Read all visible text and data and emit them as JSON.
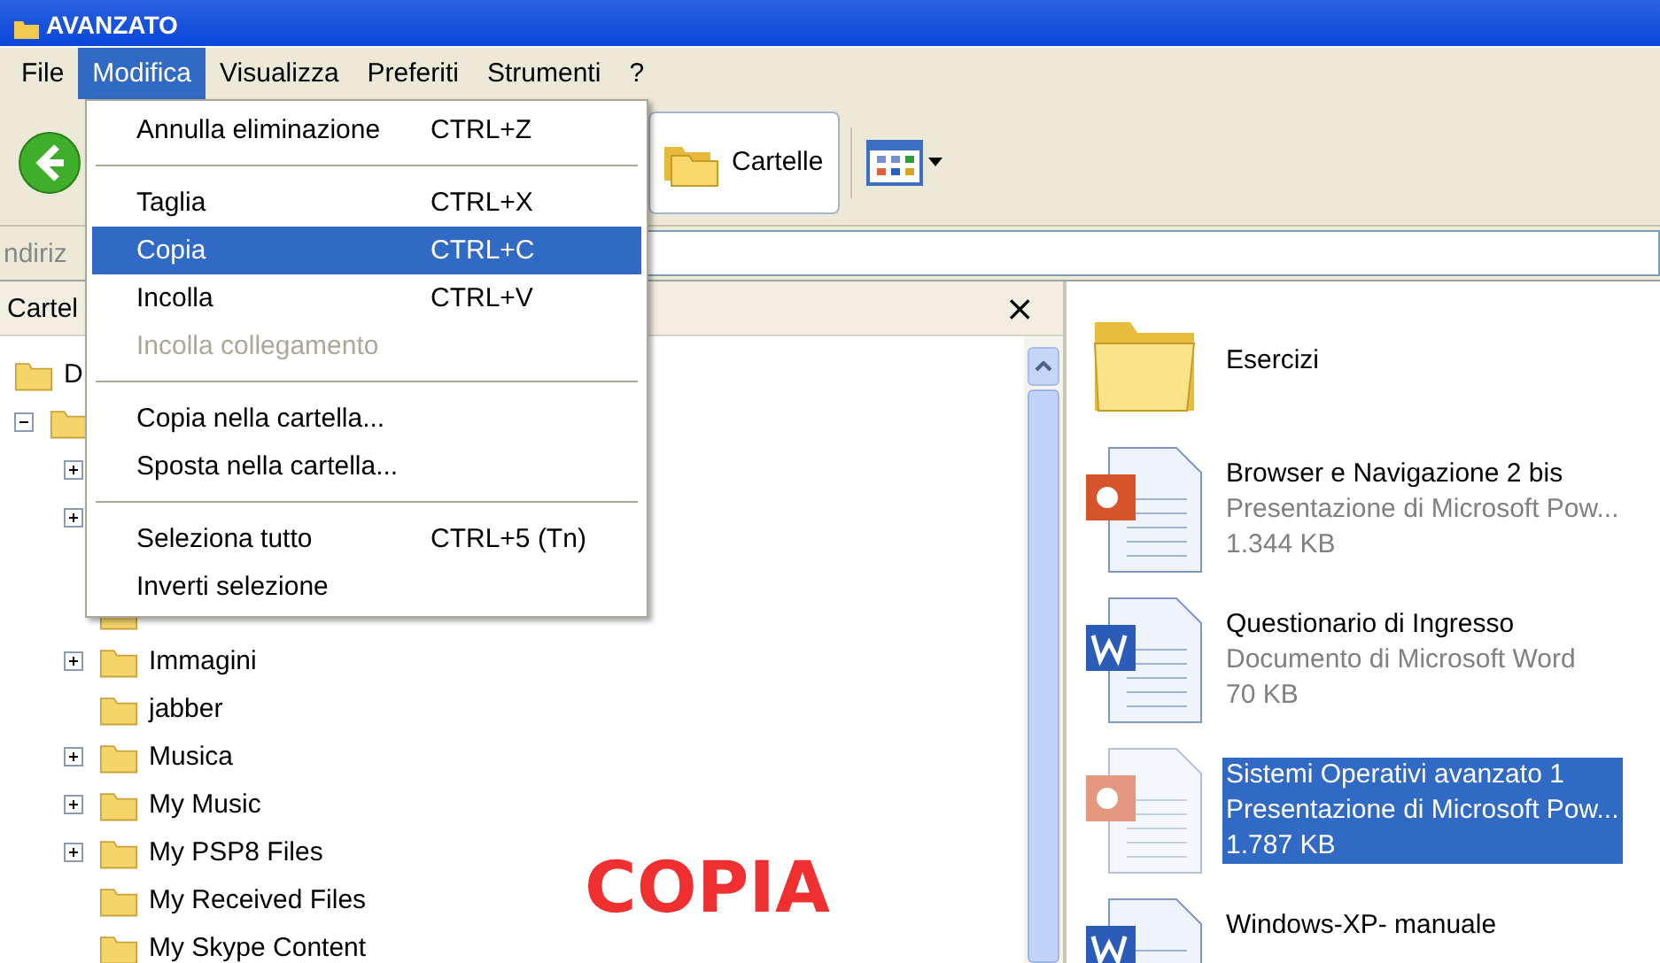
{
  "window": {
    "title": "AVANZATO"
  },
  "menu_bar": [
    {
      "label": "File",
      "selected": false
    },
    {
      "label": "Modifica",
      "selected": true
    },
    {
      "label": "Visualizza",
      "selected": false
    },
    {
      "label": "Preferiti",
      "selected": false
    },
    {
      "label": "Strumenti",
      "selected": false
    },
    {
      "label": "?",
      "selected": false
    }
  ],
  "toolbar": {
    "folders_button": "Cartelle"
  },
  "address_bar": {
    "label": "ndiriz"
  },
  "folders_pane": {
    "title": "Cartel",
    "close": "×",
    "tree": [
      {
        "label": "D",
        "kind": "leaf"
      },
      {
        "kind": "node",
        "expanded": true,
        "children": [
          {
            "kind": "node",
            "expanded": false
          },
          {
            "kind": "node",
            "expanded": false
          },
          {
            "kind": "leaf"
          },
          {
            "kind": "leaf"
          },
          {
            "label": "Immagini",
            "kind": "node",
            "expanded": false
          },
          {
            "label": "jabber",
            "kind": "leaf"
          },
          {
            "label": "Musica",
            "kind": "node",
            "expanded": false
          },
          {
            "label": "My Music",
            "kind": "node",
            "expanded": false
          },
          {
            "label": "My PSP8 Files",
            "kind": "node",
            "expanded": false
          },
          {
            "label": "My Received Files",
            "kind": "leaf"
          },
          {
            "label": "My Skype Content",
            "kind": "leaf"
          }
        ]
      }
    ]
  },
  "edit_menu": [
    {
      "kind": "item",
      "label": "Annulla eliminazione",
      "shortcut": "CTRL+Z",
      "selected": false,
      "disabled": false
    },
    {
      "kind": "separator"
    },
    {
      "kind": "item",
      "label": "Taglia",
      "shortcut": "CTRL+X",
      "selected": false,
      "disabled": false
    },
    {
      "kind": "item",
      "label": "Copia",
      "shortcut": "CTRL+C",
      "selected": true,
      "disabled": false
    },
    {
      "kind": "item",
      "label": "Incolla",
      "shortcut": "CTRL+V",
      "selected": false,
      "disabled": false
    },
    {
      "kind": "item",
      "label": "Incolla collegamento",
      "selected": false,
      "disabled": true
    },
    {
      "kind": "separator"
    },
    {
      "kind": "item",
      "label": "Copia nella cartella...",
      "selected": false,
      "disabled": false
    },
    {
      "kind": "item",
      "label": "Sposta nella cartella...",
      "selected": false,
      "disabled": false
    },
    {
      "kind": "separator"
    },
    {
      "kind": "item",
      "label": "Seleziona tutto",
      "shortcut": "CTRL+5 (Tn)",
      "selected": false,
      "disabled": false
    },
    {
      "kind": "item",
      "label": "Inverti selezione",
      "selected": false,
      "disabled": false
    }
  ],
  "files": [
    {
      "kind": "folder",
      "name": "Esercizi",
      "selected": false
    },
    {
      "kind": "presentation",
      "name": "Browser e Navigazione 2 bis",
      "type": "Presentazione di Microsoft Pow...",
      "size": "1.344 KB",
      "selected": false
    },
    {
      "kind": "document",
      "name": "Questionario di Ingresso",
      "type": "Documento di Microsoft Word",
      "size": "70 KB",
      "selected": false
    },
    {
      "kind": "presentation",
      "name": "Sistemi Operativi avanzato 1",
      "type": "Presentazione di Microsoft Pow...",
      "size": "1.787 KB",
      "selected": true
    },
    {
      "kind": "document",
      "name": "Windows-XP- manuale",
      "selected": false
    }
  ],
  "caption": "COPIA"
}
